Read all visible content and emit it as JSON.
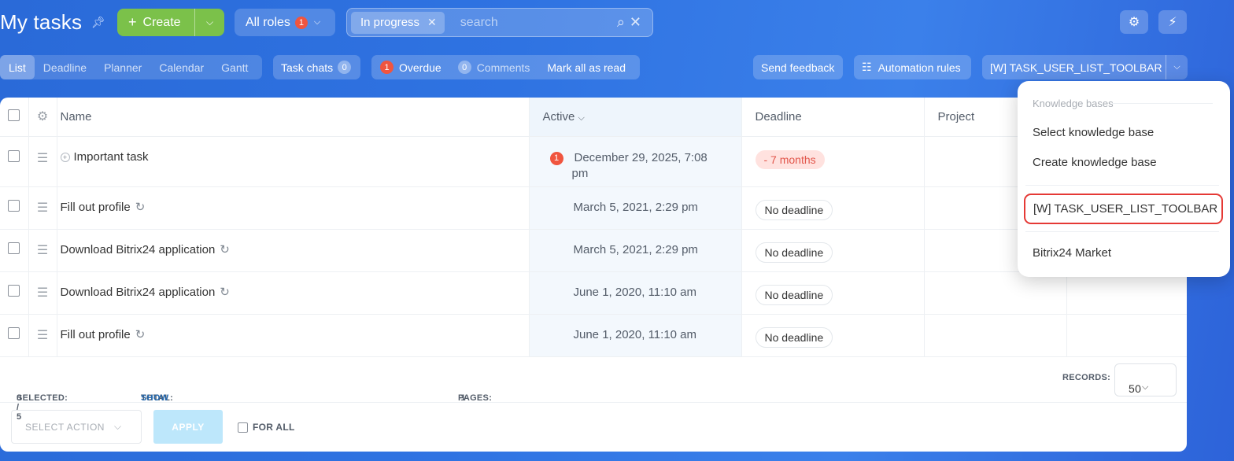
{
  "header": {
    "title": "My tasks",
    "create_label": "Create",
    "roles_label": "All roles",
    "roles_count": "1",
    "filter_chip": "In progress",
    "search_placeholder": "search"
  },
  "toolbar": {
    "tabs": [
      "List",
      "Deadline",
      "Planner",
      "Calendar",
      "Gantt"
    ],
    "task_chats_label": "Task chats",
    "task_chats_count": "0",
    "overdue_label": "Overdue",
    "overdue_count": "1",
    "comments_label": "Comments",
    "comments_count": "0",
    "mark_all_label": "Mark all as read",
    "feedback_label": "Send feedback",
    "automation_label": "Automation rules",
    "toolbar_menu_label": "[W] TASK_USER_LIST_TOOLBAR"
  },
  "table": {
    "columns": [
      "Name",
      "Active",
      "Deadline",
      "Project"
    ],
    "rows": [
      {
        "name": "Important task",
        "active_line1": "December 29, 2025, 7:08",
        "active_line2": "pm",
        "active_badge": "1",
        "deadline": "- 7 months"
      },
      {
        "name": "Fill out profile",
        "active": "March 5, 2021, 2:29 pm",
        "deadline": "No deadline"
      },
      {
        "name": "Download Bitrix24 application",
        "active": "March 5, 2021, 2:29 pm",
        "deadline": "No deadline"
      },
      {
        "name": "Download Bitrix24 application",
        "active": "June 1, 2020, 11:10 am",
        "deadline": "No deadline"
      },
      {
        "name": "Fill out profile",
        "active": "June 1, 2020, 11:10 am",
        "deadline": "No deadline"
      }
    ]
  },
  "footer": {
    "selected_label": "SELECTED:",
    "selected_value": "0 / 5",
    "total_label": "TOTAL:",
    "total_link": "SHOW",
    "pages_label": "PAGES:",
    "pages_value": "1",
    "records_label": "RECORDS:",
    "records_value": "50"
  },
  "actions": {
    "select_action_placeholder": "SELECT ACTION",
    "apply_label": "APPLY",
    "for_all_label": "FOR ALL"
  },
  "dropdown": {
    "header": "Knowledge bases",
    "items": [
      "Select knowledge base",
      "Create knowledge base",
      "[W] TASK_USER_LIST_TOOLBAR",
      "Bitrix24 Market"
    ]
  },
  "colors": {
    "highlight_outline": "#e53935",
    "create_button": "#7bc14a",
    "counter_red": "#f0553f"
  }
}
